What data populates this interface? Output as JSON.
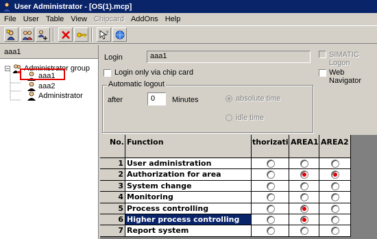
{
  "window": {
    "title": "User Administrator - [OS(1).mcp]"
  },
  "menu": [
    {
      "label": "File",
      "disabled": false
    },
    {
      "label": "User",
      "disabled": false
    },
    {
      "label": "Table",
      "disabled": false
    },
    {
      "label": "View",
      "disabled": false
    },
    {
      "label": "Chipcard",
      "disabled": true
    },
    {
      "label": "AddOns",
      "disabled": false
    },
    {
      "label": "Help",
      "disabled": false
    }
  ],
  "toolbar": {
    "buttons": [
      "add-user-icon",
      "add-group-icon",
      "copy-user-icon",
      "delete-icon",
      "key-icon",
      "help-icon",
      "network-icon"
    ]
  },
  "left_pane": {
    "header": "aaa1",
    "tree": {
      "root": "Administrator group",
      "children": [
        "aaa1",
        "aaa2",
        "Administrator"
      ]
    }
  },
  "form": {
    "login_label": "Login",
    "login_value": "aaa1",
    "simatic_logon_label": "SIMATIC Logon",
    "chip_card_label": "Login only via chip card",
    "web_navigator_label": "Web Navigator",
    "auto_logout": {
      "legend": "Automatic logout",
      "after_label": "after",
      "minutes_value": "0",
      "minutes_label": "Minutes",
      "absolute_label": "absolute time",
      "idle_label": "idle time"
    }
  },
  "grid": {
    "headers": [
      "No.",
      "Function",
      "thorizatio",
      "AREA1",
      "AREA2"
    ],
    "rows": [
      {
        "no": "1",
        "function": "User administration",
        "auth": false,
        "area1": false,
        "area2": false
      },
      {
        "no": "2",
        "function": "Authorization for area",
        "auth": false,
        "area1": true,
        "area2": true
      },
      {
        "no": "3",
        "function": "System change",
        "auth": false,
        "area1": false,
        "area2": false
      },
      {
        "no": "4",
        "function": "Monitoring",
        "auth": false,
        "area1": false,
        "area2": false
      },
      {
        "no": "5",
        "function": "Process controlling",
        "auth": false,
        "area1": true,
        "area2": false
      },
      {
        "no": "6",
        "function": "Higher process controlling",
        "auth": false,
        "area1": true,
        "area2": false
      },
      {
        "no": "7",
        "function": "Report system",
        "auth": false,
        "area1": false,
        "area2": false
      }
    ],
    "selected_row": 5
  },
  "colors": {
    "title_bar": "#0a246a",
    "selection": "#0a246a",
    "checked_radio": "#e00000",
    "highlight_box": "#e00000"
  }
}
